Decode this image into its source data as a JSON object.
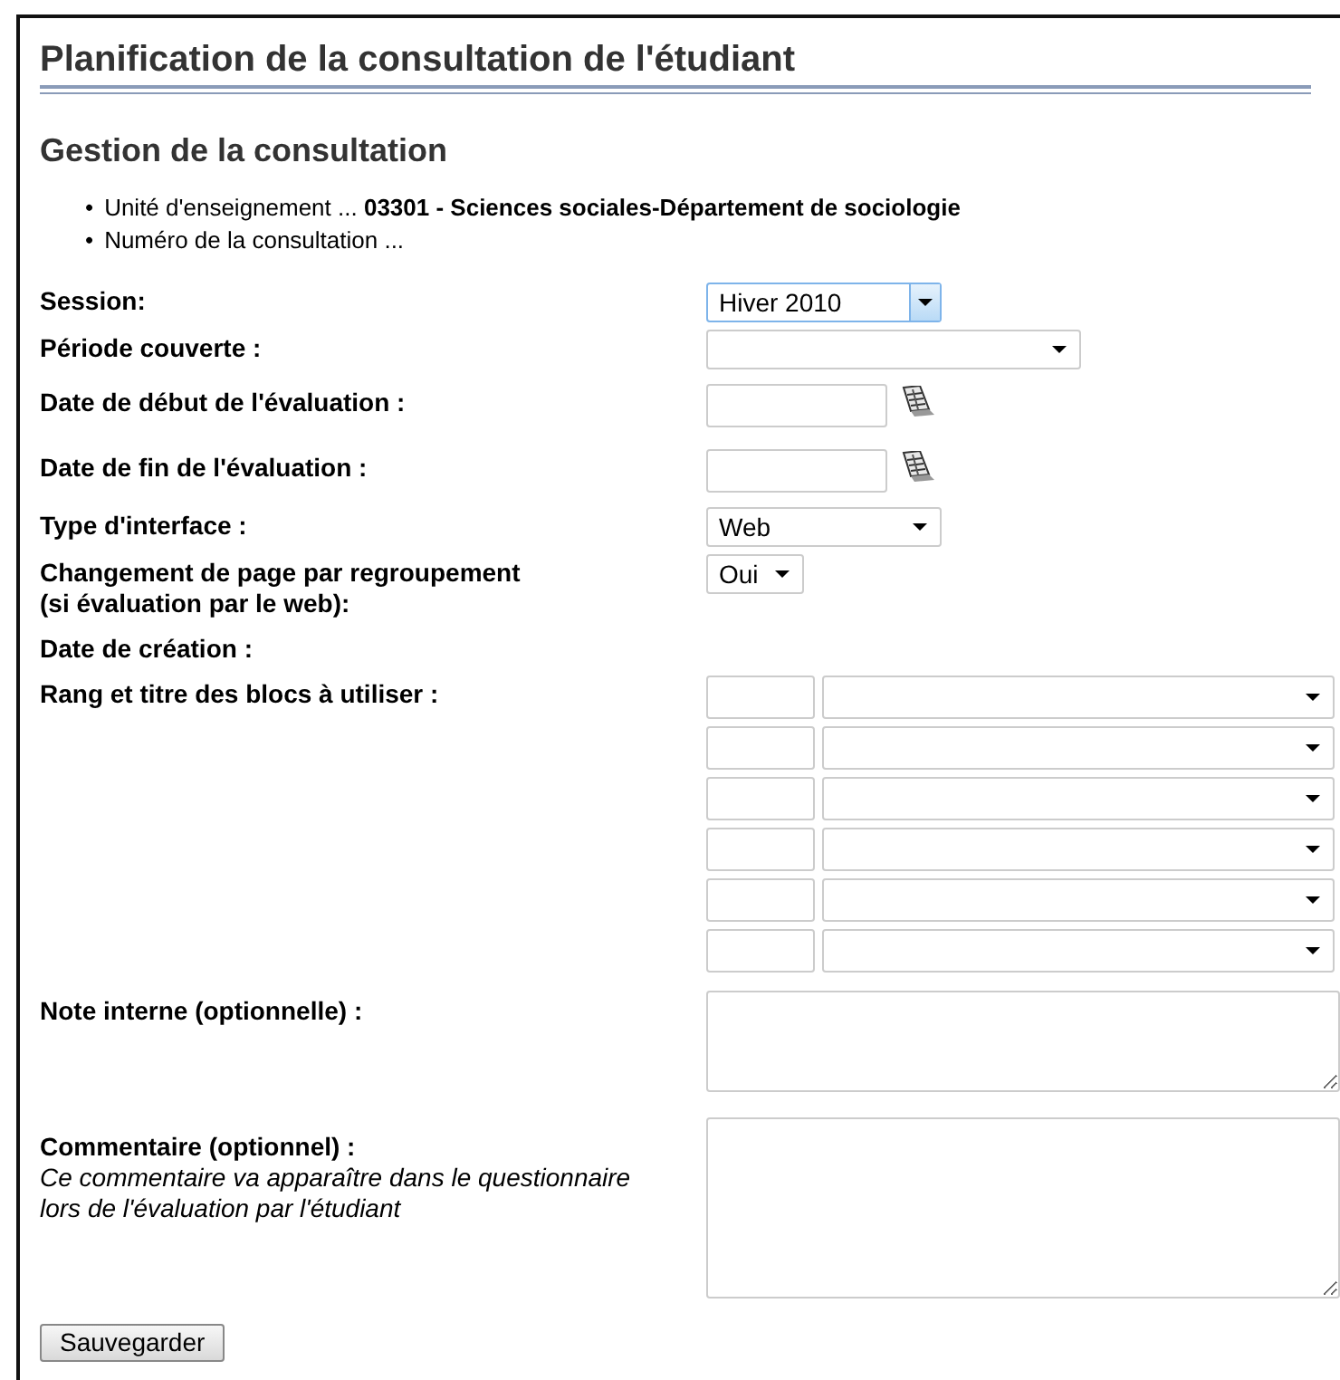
{
  "page_title": "Planification de la consultation de l'étudiant",
  "section_title": "Gestion de la consultation",
  "info": [
    {
      "bullet": "•",
      "label": "Unité d'enseignement ...",
      "value": "03301 - Sciences sociales-Département de sociologie"
    },
    {
      "bullet": "•",
      "label": "Numéro de la consultation ..."
    }
  ],
  "fields": [
    {
      "label": "Session:",
      "kind": "select",
      "value": "Hiver 2010",
      "focused": true
    },
    {
      "label": "Période couverte :",
      "kind": "select",
      "focused": false
    },
    {
      "label": "Date de début de l'évaluation :",
      "kind": "date"
    },
    {
      "label": "Date de fin de l'évaluation :",
      "kind": "date"
    },
    {
      "label": "Type d'interface :",
      "kind": "select",
      "value": "Web",
      "focused": false
    },
    {
      "label": "Changement de page par regroupement\n(si évaluation par le web):",
      "kind": "select",
      "value": "Oui",
      "focused": false
    },
    {
      "label": "Date de création :",
      "kind": "none"
    },
    {
      "label": "Rang et titre des blocs à utiliser :",
      "kind": "blocks"
    },
    {
      "label": "Note interne (optionnelle) :",
      "kind": "textarea"
    },
    {
      "label": "Commentaire (optionnel) :",
      "note": "Ce commentaire va apparaître dans le questionnaire lors de l'évaluation par l'étudiant",
      "kind": "textarea"
    }
  ],
  "save_button": "Sauvegarder"
}
